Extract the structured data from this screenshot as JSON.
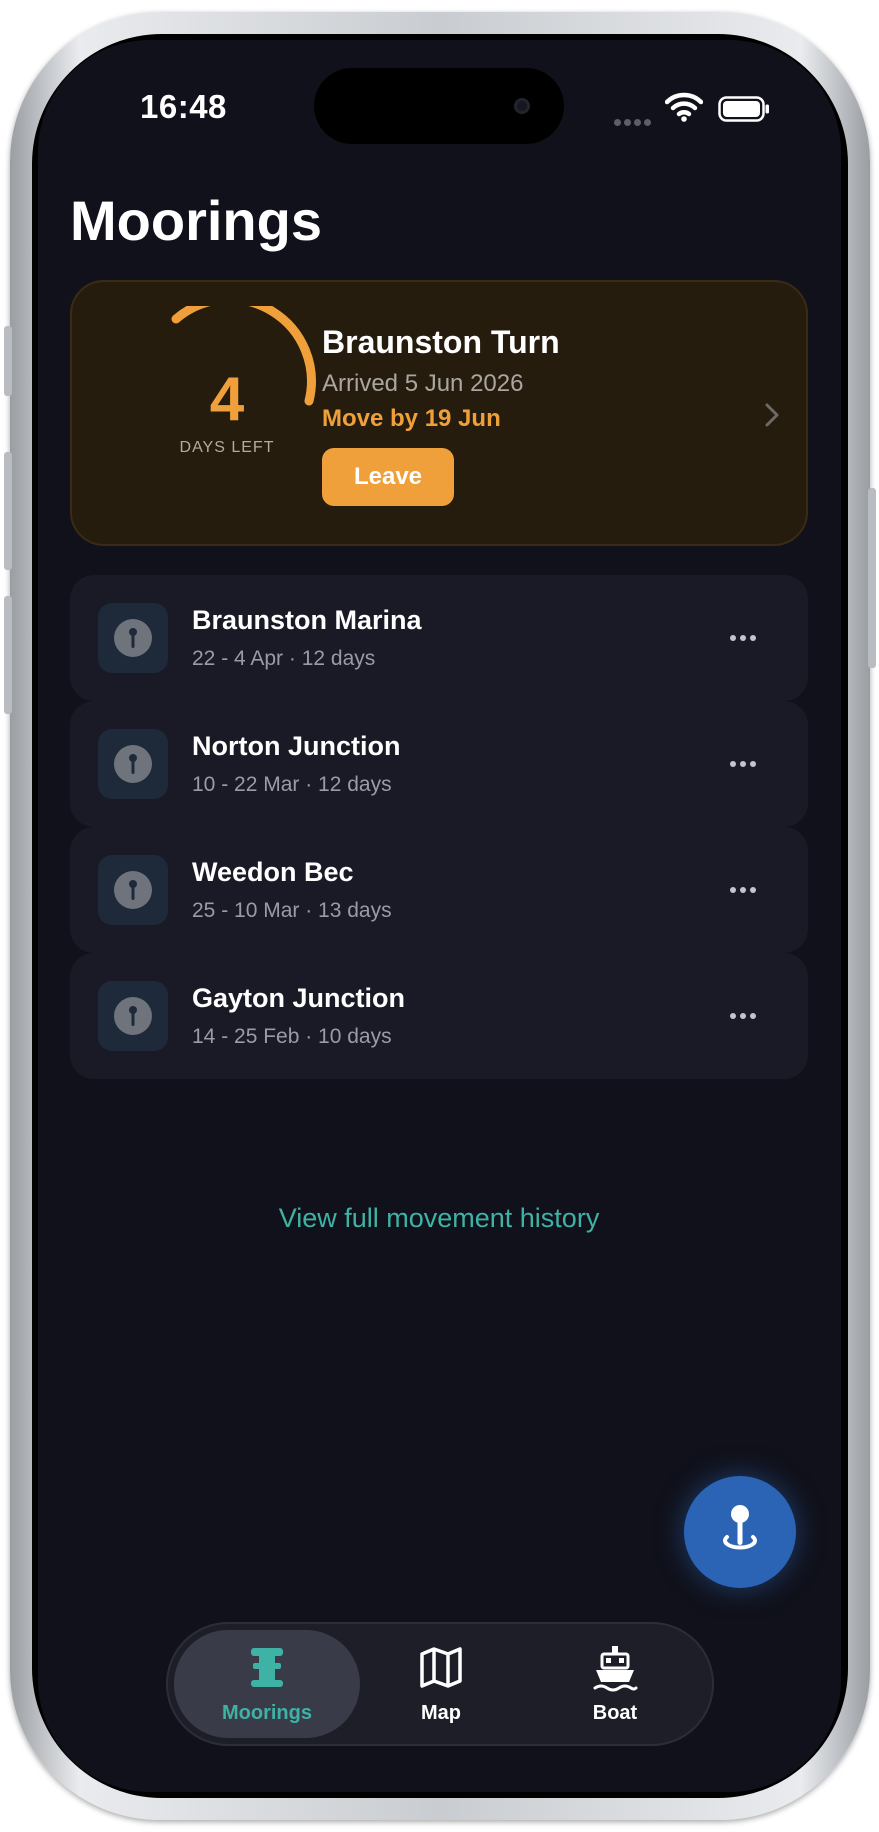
{
  "status_bar": {
    "time": "16:48"
  },
  "header": {
    "title": "Moorings"
  },
  "current_mooring": {
    "days_left": "4",
    "days_left_label": "DAYS LEFT",
    "name": "Braunston Turn",
    "arrived": "Arrived 5 Jun 2026",
    "move_by": "Move by 19 Jun",
    "leave_label": "Leave",
    "accent_color": "#f0a03a"
  },
  "history": [
    {
      "name": "Braunston Marina",
      "dates": "22 - 4 Apr · 12 days"
    },
    {
      "name": "Norton Junction",
      "dates": "10 - 22 Mar · 12 days"
    },
    {
      "name": "Weedon Bec",
      "dates": "25 - 10 Mar · 13 days"
    },
    {
      "name": "Gayton Junction",
      "dates": "14 - 25 Feb · 10 days"
    }
  ],
  "history_link": "View full movement history",
  "tabs": [
    {
      "label": "Moorings",
      "icon": "bollard-icon",
      "active": true
    },
    {
      "label": "Map",
      "icon": "map-icon",
      "active": false
    },
    {
      "label": "Boat",
      "icon": "boat-icon",
      "active": false
    }
  ],
  "colors": {
    "background": "#10111a",
    "accent_teal": "#3fb2a6",
    "fab_blue": "#2b63b5"
  }
}
